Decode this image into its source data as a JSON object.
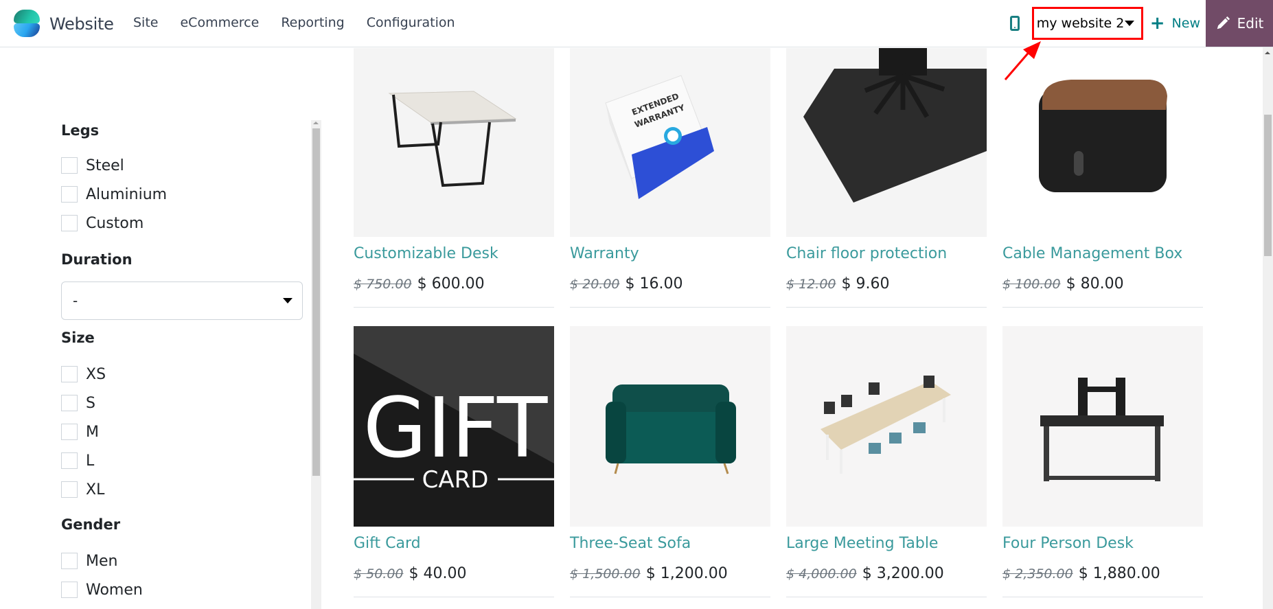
{
  "navbar": {
    "app_name": "Website",
    "menu": [
      "Site",
      "eCommerce",
      "Reporting",
      "Configuration"
    ],
    "website_selector": {
      "value": "my website 2"
    },
    "new_label": "New",
    "edit_label": "Edit",
    "colors": {
      "accent": "#017e84",
      "edit_bg": "#714b67",
      "highlight_box": "#ff0000"
    }
  },
  "filters": {
    "legs": {
      "title": "Legs",
      "options": [
        "Steel",
        "Aluminium",
        "Custom"
      ]
    },
    "duration": {
      "title": "Duration",
      "selected": "-"
    },
    "size": {
      "title": "Size",
      "options": [
        "XS",
        "S",
        "M",
        "L",
        "XL"
      ]
    },
    "gender": {
      "title": "Gender",
      "options": [
        "Men",
        "Women"
      ]
    }
  },
  "products": [
    {
      "name": "Customizable Desk",
      "old_price": "$ 750.00",
      "price": "$ 600.00",
      "image": "desk"
    },
    {
      "name": "Warranty",
      "old_price": "$ 20.00",
      "price": "$ 16.00",
      "image": "warranty-box"
    },
    {
      "name": "Chair floor protection",
      "old_price": "$ 12.00",
      "price": "$ 9.60",
      "image": "floor-mat"
    },
    {
      "name": "Cable Management Box",
      "old_price": "$ 100.00",
      "price": "$ 80.00",
      "image": "cable-box"
    },
    {
      "name": "Gift Card",
      "old_price": "$ 50.00",
      "price": "$ 40.00",
      "image": "gift-card",
      "image_text": {
        "big": "GIFT",
        "small": "CARD"
      }
    },
    {
      "name": "Three-Seat Sofa",
      "old_price": "$ 1,500.00",
      "price": "$ 1,200.00",
      "image": "sofa"
    },
    {
      "name": "Large Meeting Table",
      "old_price": "$ 4,000.00",
      "price": "$ 3,200.00",
      "image": "meeting-table"
    },
    {
      "name": "Four Person Desk",
      "old_price": "$ 2,350.00",
      "price": "$ 1,880.00",
      "image": "four-person-desk"
    }
  ],
  "warranty_box_text": "EXTENDED WARRANTY"
}
